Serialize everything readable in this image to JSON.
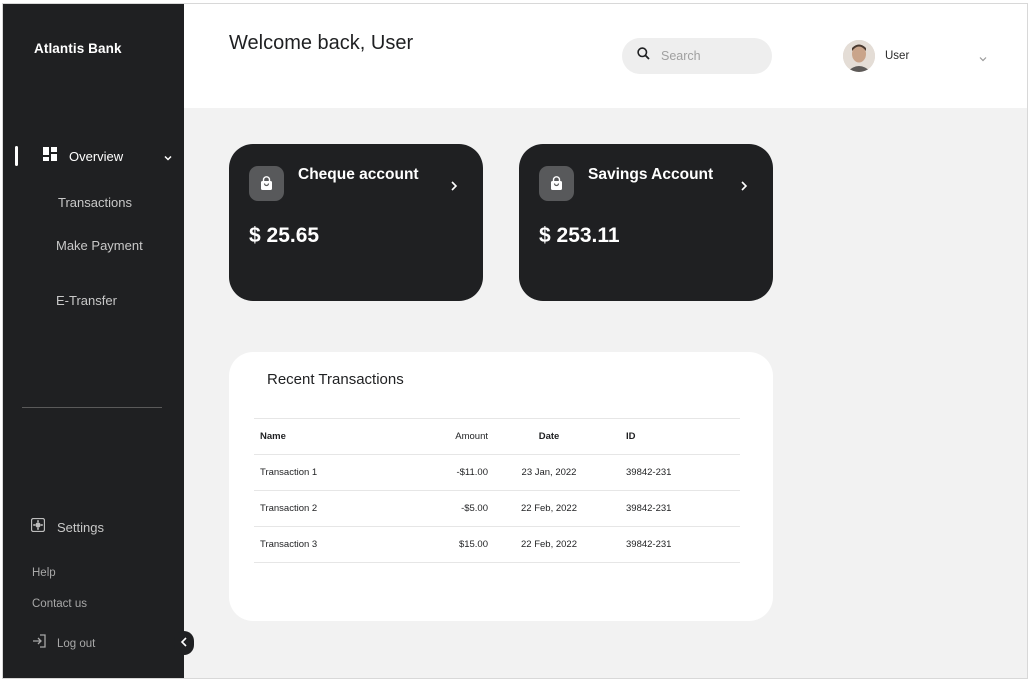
{
  "sidebar": {
    "brand": "Atlantis Bank",
    "overview_label": "Overview",
    "sub_items": [
      "Transactions",
      "Make Payment",
      "E-Transfer"
    ],
    "settings_label": "Settings",
    "help_label": "Help",
    "contact_label": "Contact us",
    "logout_label": "Log out"
  },
  "header": {
    "welcome": "Welcome back, User",
    "search_placeholder": "Search",
    "user_name": "User"
  },
  "accounts": [
    {
      "title": "Cheque account",
      "balance": "$ 25.65"
    },
    {
      "title": "Savings Account",
      "balance": "$ 253.11"
    }
  ],
  "transactions": {
    "title": "Recent Transactions",
    "columns": [
      "Name",
      "Amount",
      "Date",
      "ID"
    ],
    "rows": [
      {
        "name": "Transaction 1",
        "amount": "-$11.00",
        "date": "23 Jan, 2022",
        "id": "39842-231"
      },
      {
        "name": "Transaction 2",
        "amount": "-$5.00",
        "date": "22 Feb, 2022",
        "id": "39842-231"
      },
      {
        "name": "Transaction 3",
        "amount": "$15.00",
        "date": "22 Feb, 2022",
        "id": "39842-231"
      }
    ]
  },
  "colors": {
    "sidebar_bg": "#1f2022",
    "card_bg": "#1f2022",
    "page_bg": "#f2f2f2"
  },
  "icons": [
    "dashboard-icon",
    "chevron-down-icon",
    "settings-icon",
    "logout-icon",
    "chevron-left-icon",
    "search-icon",
    "shopping-bag-icon",
    "chevron-right-icon"
  ]
}
